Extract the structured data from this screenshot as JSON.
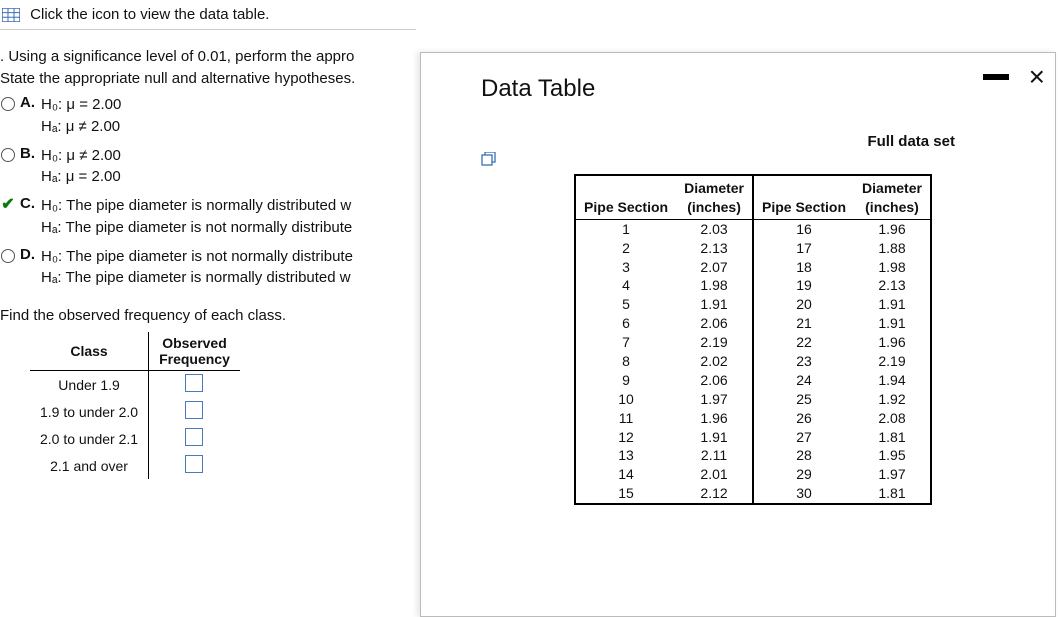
{
  "top_instruction": "Click the icon to view the data table.",
  "question": {
    "part_a": ". Using a significance level of 0.01, perform the appro",
    "state": "State the appropriate null and alternative hypotheses.",
    "options": {
      "A": {
        "h0": "H₀: μ = 2.00",
        "ha": "Hₐ: μ ≠ 2.00"
      },
      "B": {
        "h0": "H₀: μ ≠ 2.00",
        "ha": "Hₐ: μ = 2.00"
      },
      "C": {
        "h0": "H₀: The pipe diameter is normally distributed w",
        "ha": "Hₐ: The pipe diameter is not normally distribute"
      },
      "D": {
        "h0": "H₀: The pipe diameter is not normally distribute",
        "ha": "Hₐ: The pipe diameter is normally distributed w"
      }
    },
    "selected": "C",
    "find_freq": "Find the observed frequency of each class.",
    "freq_headers": {
      "class": "Class",
      "obs": "Observed\nFrequency"
    },
    "freq_rows": [
      "Under 1.9",
      "1.9 to under 2.0",
      "2.0 to under 2.1",
      "2.1 and over"
    ]
  },
  "modal": {
    "title": "Data Table",
    "full": "Full data set",
    "headers": {
      "ps": "Pipe Section",
      "d": "Diameter",
      "d2": "(inches)"
    },
    "rows_left": [
      {
        "s": 1,
        "d": 2.03
      },
      {
        "s": 2,
        "d": 2.13
      },
      {
        "s": 3,
        "d": 2.07
      },
      {
        "s": 4,
        "d": 1.98
      },
      {
        "s": 5,
        "d": 1.91
      },
      {
        "s": 6,
        "d": 2.06
      },
      {
        "s": 7,
        "d": 2.19
      },
      {
        "s": 8,
        "d": 2.02
      },
      {
        "s": 9,
        "d": 2.06
      },
      {
        "s": 10,
        "d": 1.97
      },
      {
        "s": 11,
        "d": 1.96
      },
      {
        "s": 12,
        "d": 1.91
      },
      {
        "s": 13,
        "d": 2.11
      },
      {
        "s": 14,
        "d": 2.01
      },
      {
        "s": 15,
        "d": 2.12
      }
    ],
    "rows_right": [
      {
        "s": 16,
        "d": 1.96
      },
      {
        "s": 17,
        "d": 1.88
      },
      {
        "s": 18,
        "d": 1.98
      },
      {
        "s": 19,
        "d": 2.13
      },
      {
        "s": 20,
        "d": 1.91
      },
      {
        "s": 21,
        "d": 1.91
      },
      {
        "s": 22,
        "d": 1.96
      },
      {
        "s": 23,
        "d": 2.19
      },
      {
        "s": 24,
        "d": 1.94
      },
      {
        "s": 25,
        "d": 1.92
      },
      {
        "s": 26,
        "d": 2.08
      },
      {
        "s": 27,
        "d": 1.81
      },
      {
        "s": 28,
        "d": 1.95
      },
      {
        "s": 29,
        "d": 1.97
      },
      {
        "s": 30,
        "d": 1.81
      }
    ]
  }
}
